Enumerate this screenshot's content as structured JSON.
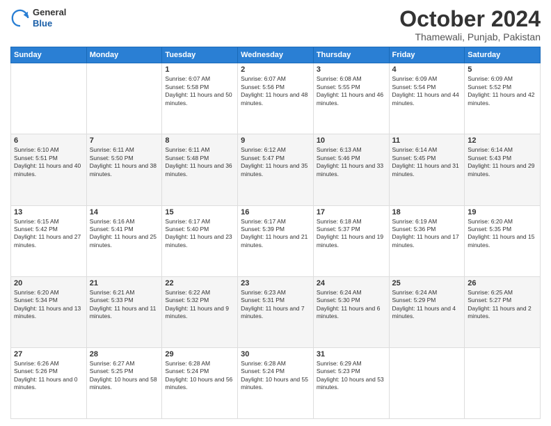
{
  "header": {
    "logo": {
      "general": "General",
      "blue": "Blue"
    },
    "title": "October 2024",
    "location": "Thamewali, Punjab, Pakistan"
  },
  "weekdays": [
    "Sunday",
    "Monday",
    "Tuesday",
    "Wednesday",
    "Thursday",
    "Friday",
    "Saturday"
  ],
  "weeks": [
    [
      {
        "day": "",
        "content": ""
      },
      {
        "day": "",
        "content": ""
      },
      {
        "day": "1",
        "content": "Sunrise: 6:07 AM\nSunset: 5:58 PM\nDaylight: 11 hours and 50 minutes."
      },
      {
        "day": "2",
        "content": "Sunrise: 6:07 AM\nSunset: 5:56 PM\nDaylight: 11 hours and 48 minutes."
      },
      {
        "day": "3",
        "content": "Sunrise: 6:08 AM\nSunset: 5:55 PM\nDaylight: 11 hours and 46 minutes."
      },
      {
        "day": "4",
        "content": "Sunrise: 6:09 AM\nSunset: 5:54 PM\nDaylight: 11 hours and 44 minutes."
      },
      {
        "day": "5",
        "content": "Sunrise: 6:09 AM\nSunset: 5:52 PM\nDaylight: 11 hours and 42 minutes."
      }
    ],
    [
      {
        "day": "6",
        "content": "Sunrise: 6:10 AM\nSunset: 5:51 PM\nDaylight: 11 hours and 40 minutes."
      },
      {
        "day": "7",
        "content": "Sunrise: 6:11 AM\nSunset: 5:50 PM\nDaylight: 11 hours and 38 minutes."
      },
      {
        "day": "8",
        "content": "Sunrise: 6:11 AM\nSunset: 5:48 PM\nDaylight: 11 hours and 36 minutes."
      },
      {
        "day": "9",
        "content": "Sunrise: 6:12 AM\nSunset: 5:47 PM\nDaylight: 11 hours and 35 minutes."
      },
      {
        "day": "10",
        "content": "Sunrise: 6:13 AM\nSunset: 5:46 PM\nDaylight: 11 hours and 33 minutes."
      },
      {
        "day": "11",
        "content": "Sunrise: 6:14 AM\nSunset: 5:45 PM\nDaylight: 11 hours and 31 minutes."
      },
      {
        "day": "12",
        "content": "Sunrise: 6:14 AM\nSunset: 5:43 PM\nDaylight: 11 hours and 29 minutes."
      }
    ],
    [
      {
        "day": "13",
        "content": "Sunrise: 6:15 AM\nSunset: 5:42 PM\nDaylight: 11 hours and 27 minutes."
      },
      {
        "day": "14",
        "content": "Sunrise: 6:16 AM\nSunset: 5:41 PM\nDaylight: 11 hours and 25 minutes."
      },
      {
        "day": "15",
        "content": "Sunrise: 6:17 AM\nSunset: 5:40 PM\nDaylight: 11 hours and 23 minutes."
      },
      {
        "day": "16",
        "content": "Sunrise: 6:17 AM\nSunset: 5:39 PM\nDaylight: 11 hours and 21 minutes."
      },
      {
        "day": "17",
        "content": "Sunrise: 6:18 AM\nSunset: 5:37 PM\nDaylight: 11 hours and 19 minutes."
      },
      {
        "day": "18",
        "content": "Sunrise: 6:19 AM\nSunset: 5:36 PM\nDaylight: 11 hours and 17 minutes."
      },
      {
        "day": "19",
        "content": "Sunrise: 6:20 AM\nSunset: 5:35 PM\nDaylight: 11 hours and 15 minutes."
      }
    ],
    [
      {
        "day": "20",
        "content": "Sunrise: 6:20 AM\nSunset: 5:34 PM\nDaylight: 11 hours and 13 minutes."
      },
      {
        "day": "21",
        "content": "Sunrise: 6:21 AM\nSunset: 5:33 PM\nDaylight: 11 hours and 11 minutes."
      },
      {
        "day": "22",
        "content": "Sunrise: 6:22 AM\nSunset: 5:32 PM\nDaylight: 11 hours and 9 minutes."
      },
      {
        "day": "23",
        "content": "Sunrise: 6:23 AM\nSunset: 5:31 PM\nDaylight: 11 hours and 7 minutes."
      },
      {
        "day": "24",
        "content": "Sunrise: 6:24 AM\nSunset: 5:30 PM\nDaylight: 11 hours and 6 minutes."
      },
      {
        "day": "25",
        "content": "Sunrise: 6:24 AM\nSunset: 5:29 PM\nDaylight: 11 hours and 4 minutes."
      },
      {
        "day": "26",
        "content": "Sunrise: 6:25 AM\nSunset: 5:27 PM\nDaylight: 11 hours and 2 minutes."
      }
    ],
    [
      {
        "day": "27",
        "content": "Sunrise: 6:26 AM\nSunset: 5:26 PM\nDaylight: 11 hours and 0 minutes."
      },
      {
        "day": "28",
        "content": "Sunrise: 6:27 AM\nSunset: 5:25 PM\nDaylight: 10 hours and 58 minutes."
      },
      {
        "day": "29",
        "content": "Sunrise: 6:28 AM\nSunset: 5:24 PM\nDaylight: 10 hours and 56 minutes."
      },
      {
        "day": "30",
        "content": "Sunrise: 6:28 AM\nSunset: 5:24 PM\nDaylight: 10 hours and 55 minutes."
      },
      {
        "day": "31",
        "content": "Sunrise: 6:29 AM\nSunset: 5:23 PM\nDaylight: 10 hours and 53 minutes."
      },
      {
        "day": "",
        "content": ""
      },
      {
        "day": "",
        "content": ""
      }
    ]
  ]
}
